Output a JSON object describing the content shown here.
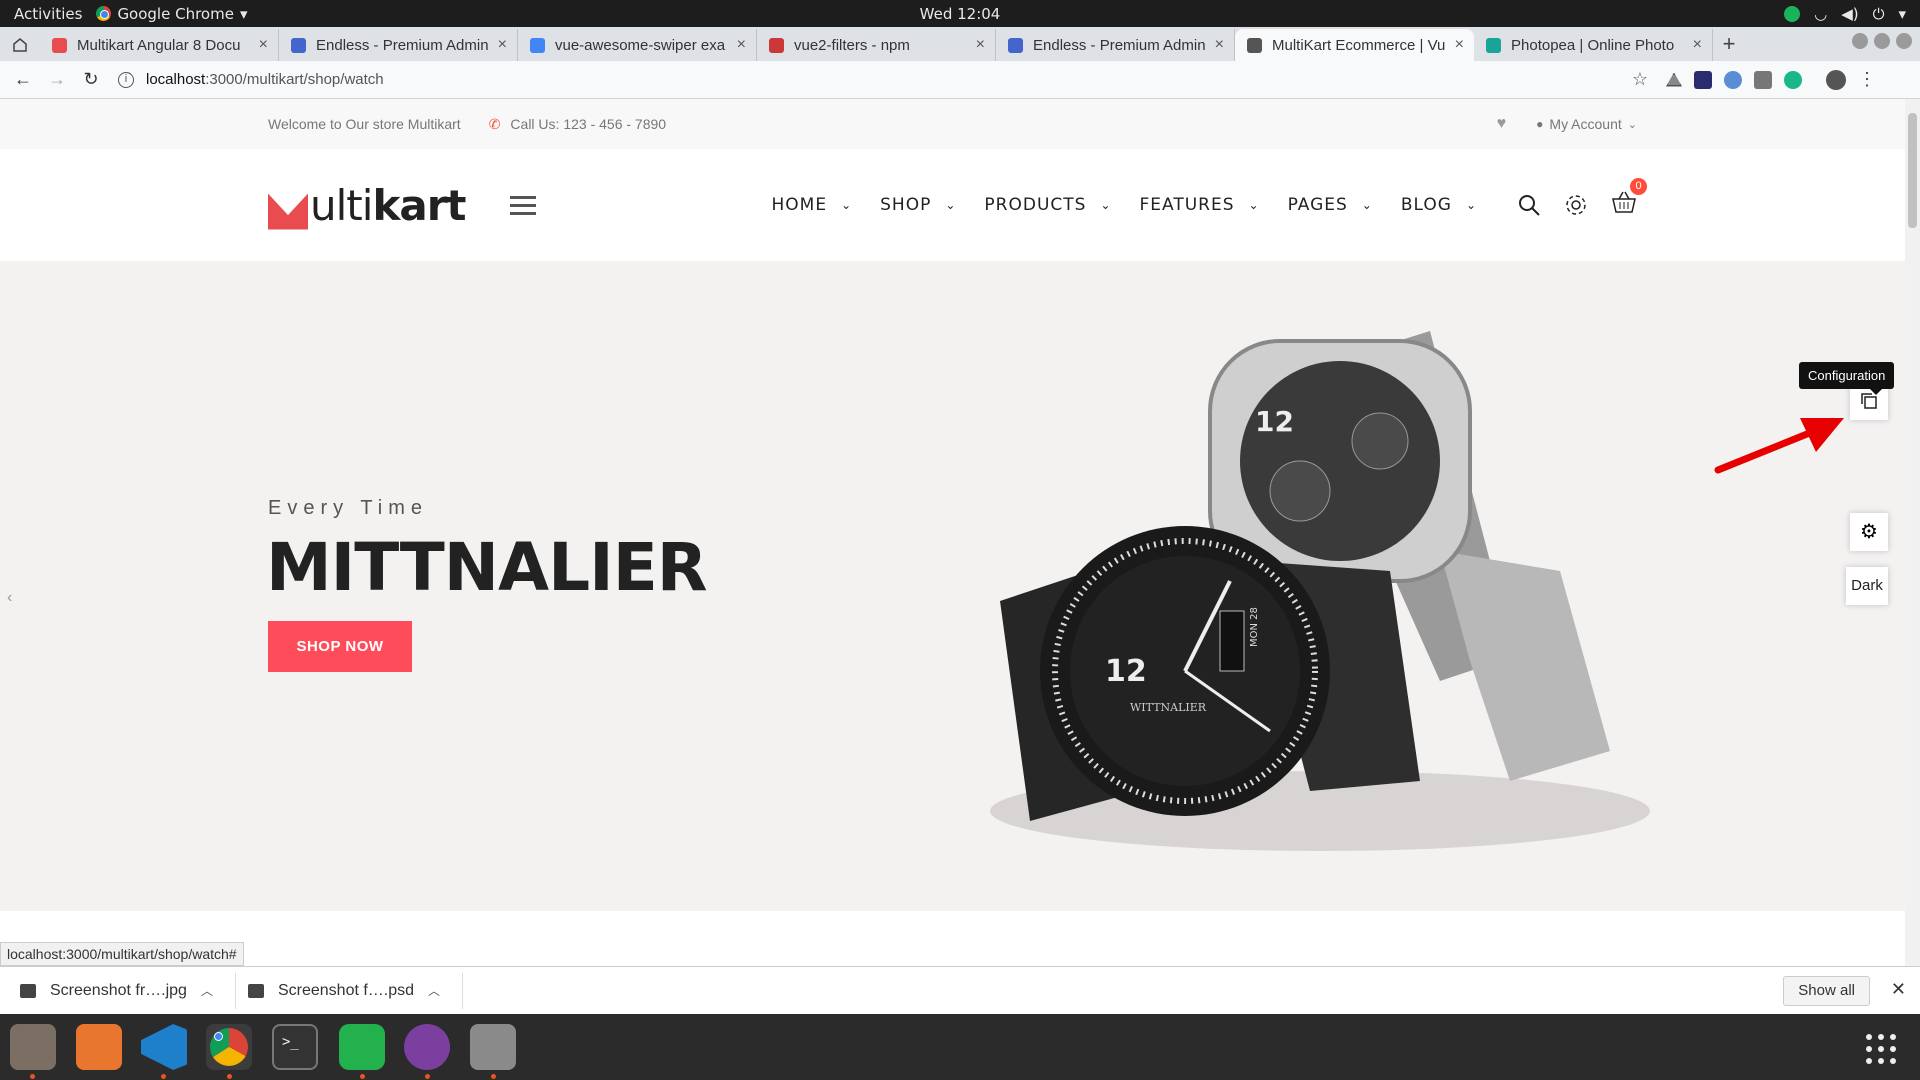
{
  "system": {
    "activities": "Activities",
    "app_menu": "Google Chrome",
    "clock": "Wed 12:04"
  },
  "tabs": [
    {
      "title": "Multikart Angular 8 Docu",
      "favicon_color": "#e84c4f",
      "active": false
    },
    {
      "title": "Endless - Premium Admin",
      "favicon_color": "#4466cc",
      "active": false
    },
    {
      "title": "vue-awesome-swiper exa",
      "favicon_color": "#4285f4",
      "active": false
    },
    {
      "title": "vue2-filters - npm",
      "favicon_color": "#cb3837",
      "active": false
    },
    {
      "title": "Endless - Premium Admin",
      "favicon_color": "#4466cc",
      "active": false
    },
    {
      "title": "MultiKart Ecommerce | Vu",
      "favicon_color": "#555555",
      "active": true
    },
    {
      "title": "Photopea | Online Photo",
      "favicon_color": "#18a497",
      "active": false
    }
  ],
  "address": {
    "url_host": "localhost",
    "url_rest": ":3000/multikart/shop/watch"
  },
  "site": {
    "topbar": {
      "welcome": "Welcome to Our store Multikart",
      "call": "Call Us: 123 - 456 - 7890",
      "account": "My Account"
    },
    "logo": {
      "prefix": "ulti",
      "suffix": "kart"
    },
    "nav": [
      "HOME",
      "SHOP",
      "PRODUCTS",
      "FEATURES",
      "PAGES",
      "BLOG"
    ],
    "cart_count": "0",
    "hero": {
      "subtitle": "Every Time",
      "headline": "MITTNALIER",
      "button": "SHOP NOW",
      "watch_brand": "WITTNALIER",
      "watch_number": "12",
      "watch_date": "MON 28"
    },
    "side": {
      "tooltip": "Configuration",
      "dark_label": "Dark"
    },
    "accent": "#ff4c5a"
  },
  "status_url": "localhost:3000/multikart/shop/watch#",
  "downloads": {
    "items": [
      "Screenshot fr….jpg",
      "Screenshot f….psd"
    ],
    "show_all": "Show all"
  }
}
